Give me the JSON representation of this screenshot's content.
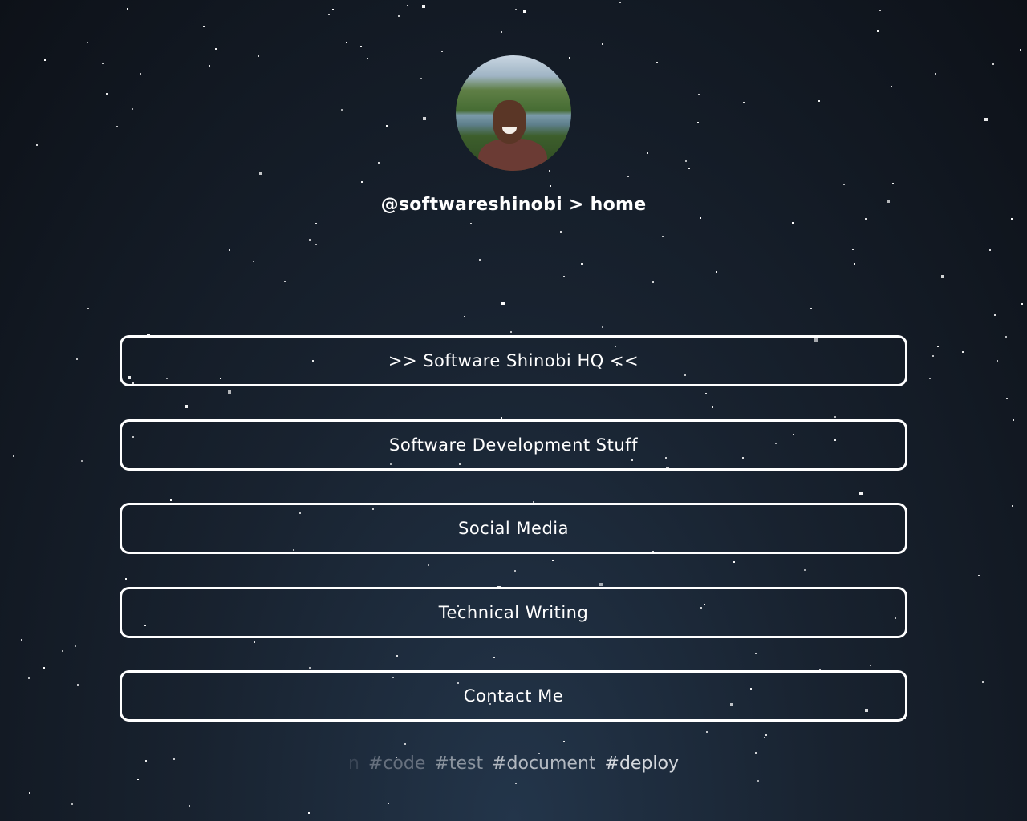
{
  "profile": {
    "avatar_alt": "avatar",
    "handle": "@softwareshinobi > home"
  },
  "links": [
    {
      "label": ">> Software Shinobi HQ <<"
    },
    {
      "label": "Software Development Stuff"
    },
    {
      "label": "Social Media"
    },
    {
      "label": "Technical Writing"
    },
    {
      "label": "Contact Me"
    }
  ],
  "tags": [
    {
      "text": "n",
      "color": "#3a4656"
    },
    {
      "text": "#code",
      "color": "#66707e"
    },
    {
      "text": "#test",
      "color": "#8a939e"
    },
    {
      "text": "#document",
      "color": "#b3b9c1"
    },
    {
      "text": "#deploy",
      "color": "#d4d8dd"
    }
  ],
  "colors": {
    "button_border": "#ffffff",
    "text": "#ffffff"
  }
}
